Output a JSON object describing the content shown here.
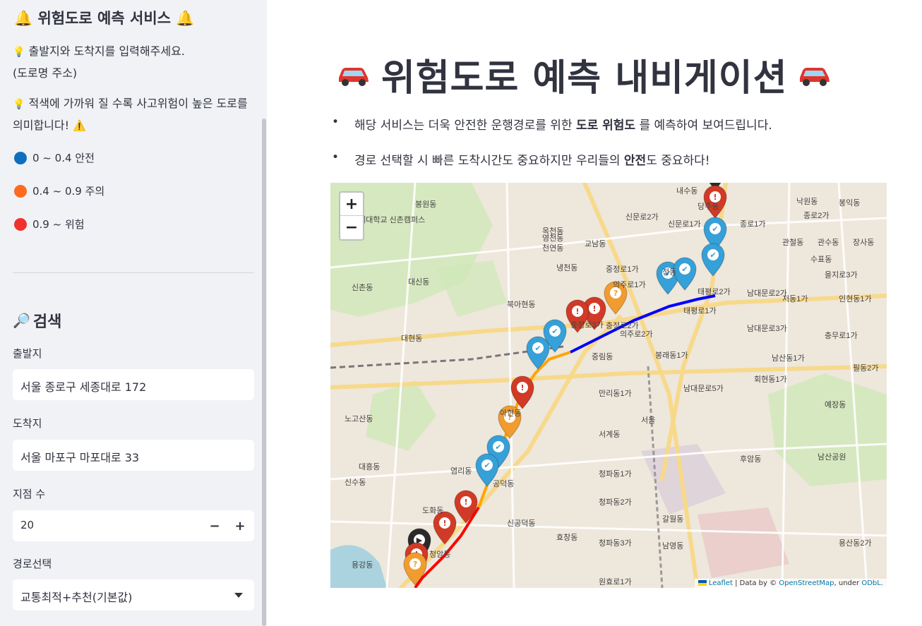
{
  "sidebar": {
    "title": "위험도로 예측 서비스",
    "info1": "출발지와 도착지를 입력해주세요.",
    "info1b": "(도로명 주소)",
    "info2": "적색에 가까워 질 수록 사고위험이 높은 도로를 의미합니다!",
    "legend": [
      {
        "label": "0 ~ 0.4 안전",
        "color": "#0f6fbf"
      },
      {
        "label": "0.4 ~ 0.9 주의",
        "color": "#ff6a1f"
      },
      {
        "label": "0.9 ~ 위험",
        "color": "#f0322f"
      }
    ],
    "search_title": "검색",
    "origin_label": "출발지",
    "origin_value": "서울 종로구 세종대로 172",
    "dest_label": "도착지",
    "dest_value": "서울 마포구 마포대로 33",
    "points_label": "지점 수",
    "points_value": "20",
    "route_label": "경로선택",
    "route_value": "교통최적+추천(기본값)"
  },
  "main": {
    "title": "위험도로 예측 내비게이션",
    "bullet1_pre": "해당 서비스는 더욱 안전한 운행경로를 위한 ",
    "bullet1_bold": "도로 위험도",
    "bullet1_post": " 를 예측하여 보여드립니다.",
    "bullet2_pre": "경로 선택할 시 빠른 도착시간도 중요하지만 우리들의 ",
    "bullet2_bold": "안전",
    "bullet2_post": "도 중요하다!"
  },
  "map": {
    "zoom_in": "+",
    "zoom_out": "−",
    "attr_leaflet": "Leaflet",
    "attr_mid": " | Data by © ",
    "attr_osm": "OpenStreetMap",
    "attr_under": ", under ",
    "attr_odbl": "ODbL.",
    "labels": [
      "내수동",
      "당주동",
      "신문로2가",
      "신문로1가",
      "종로1가",
      "낙원동",
      "봉익동",
      "종로2가",
      "북아현동",
      "중림동",
      "의주로1가",
      "의주로2가",
      "정동",
      "태평로2가",
      "남대문로2가",
      "남대문로3가",
      "봉래동1가",
      "남산동1가",
      "회현동1가",
      "예장동",
      "필동2가",
      "충무로1가",
      "인현동1가",
      "저동1가",
      "을지로3가",
      "관철동",
      "관수동",
      "장사동",
      "수표동",
      "대현동",
      "신촌동",
      "대신동",
      "봉원동",
      "영천동",
      "옥천동",
      "천연동",
      "교남동",
      "냉천동",
      "중정로1가",
      "충정로3가",
      "아현동",
      "만리동1가",
      "남대문로5가",
      "서계동",
      "청파동1가",
      "청파동2가",
      "청파동3가",
      "갈월동",
      "후암동",
      "남산공원",
      "용산동2가",
      "신공덕동",
      "효창동",
      "원효로1가",
      "용강동",
      "염리동",
      "노고산동",
      "대흥동",
      "신수동",
      "도화동",
      "공덕동",
      "청암동",
      "남영동",
      "서울",
      "충정로2가",
      "태평로1가",
      "연세대학교 신촌캠퍼스"
    ]
  },
  "colors": {
    "safe": "#36a0d8",
    "caution": "#f09c2f",
    "danger": "#d13a26",
    "route_blue": "#0000ff",
    "route_orange": "#ffa500",
    "route_red": "#ff0000"
  }
}
